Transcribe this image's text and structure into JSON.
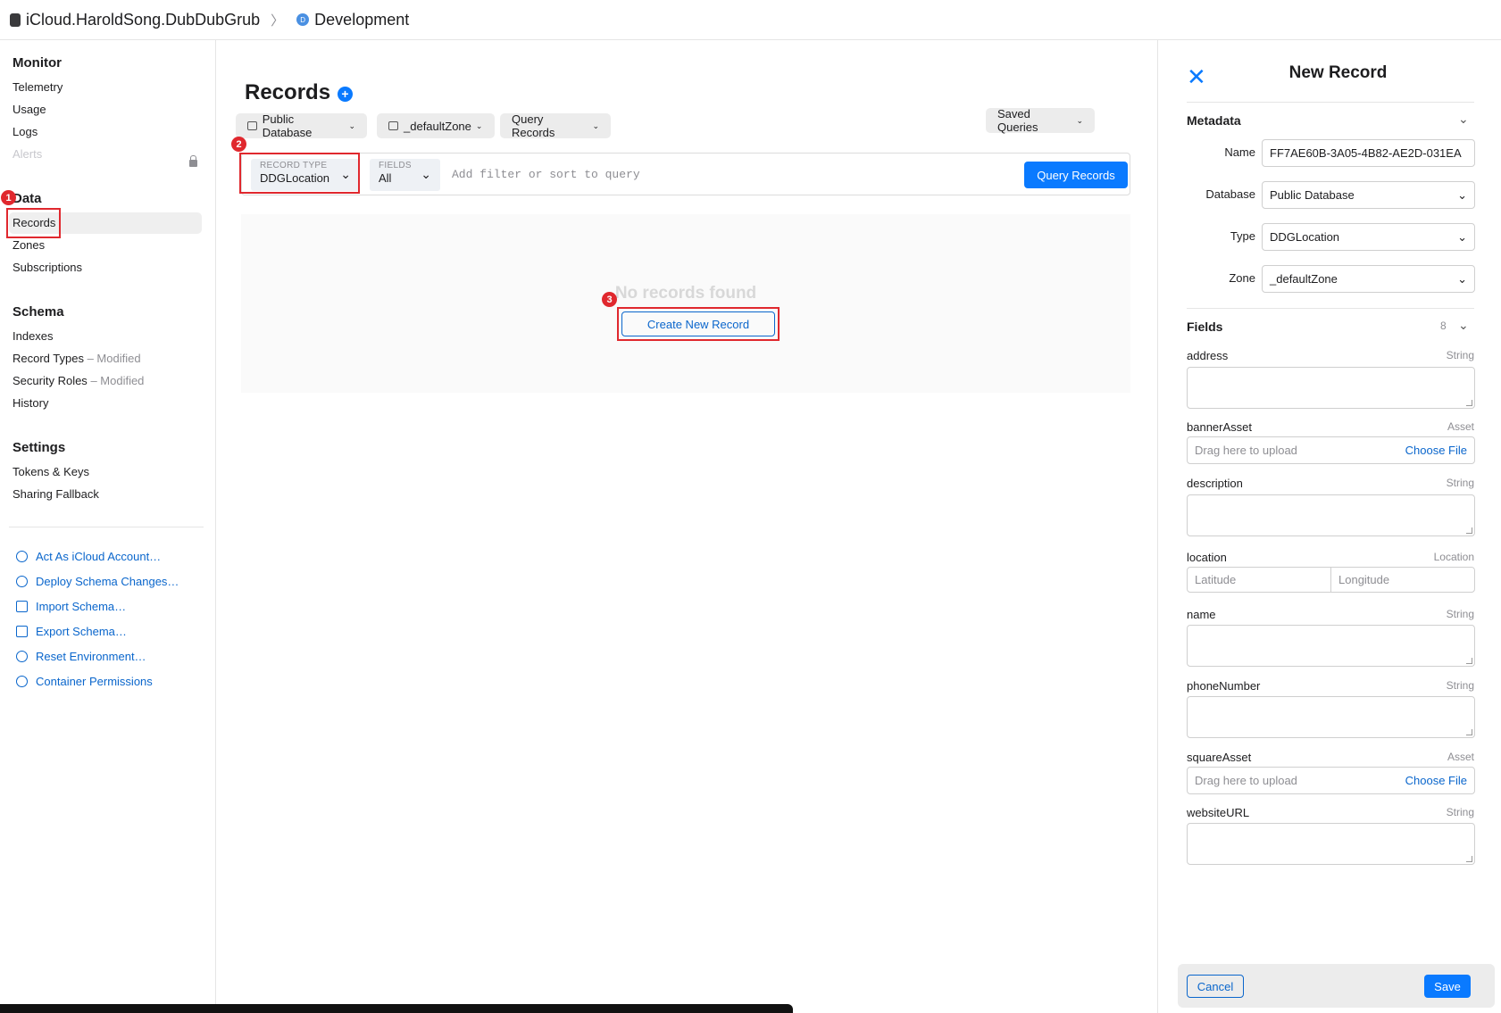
{
  "breadcrumb": {
    "container": "iCloud.HaroldSong.DubDubGrub",
    "environment_initial": "D",
    "environment": "Development"
  },
  "sidebar": {
    "sections": {
      "monitor": {
        "title": "Monitor",
        "items": [
          "Telemetry",
          "Usage",
          "Logs",
          "Alerts"
        ]
      },
      "data": {
        "title": "Data",
        "items": [
          "Records",
          "Zones",
          "Subscriptions"
        ]
      },
      "schema": {
        "title": "Schema",
        "items": [
          "Indexes",
          "Record Types",
          "Security Roles",
          "History"
        ],
        "modified_suffix": "– Modified"
      },
      "settings": {
        "title": "Settings",
        "items": [
          "Tokens & Keys",
          "Sharing Fallback"
        ]
      }
    },
    "actions": [
      "Act As iCloud Account…",
      "Deploy Schema Changes…",
      "Import Schema…",
      "Export Schema…",
      "Reset Environment…",
      "Container Permissions"
    ],
    "selected": "Records"
  },
  "annotations": [
    "1",
    "2",
    "3"
  ],
  "main": {
    "title": "Records",
    "add_icon": "+",
    "toolbar": {
      "database": "Public Database",
      "zone": "_defaultZone",
      "mode": "Query Records",
      "saved_queries": "Saved Queries"
    },
    "query": {
      "record_type_label": "RECORD TYPE",
      "record_type_value": "DDGLocation",
      "fields_label": "FIELDS",
      "fields_value": "All",
      "placeholder": "Add filter or sort to query",
      "button": "Query Records"
    },
    "empty_text": "No records found",
    "create_button": "Create New Record"
  },
  "panel": {
    "title": "New Record",
    "metadata_title": "Metadata",
    "metadata": [
      {
        "label": "Name",
        "value": "FF7AE60B-3A05-4B82-AE2D-031EA"
      },
      {
        "label": "Database",
        "value": "Public Database"
      },
      {
        "label": "Type",
        "value": "DDGLocation"
      },
      {
        "label": "Zone",
        "value": "_defaultZone"
      }
    ],
    "fields_title": "Fields",
    "fields_count": "8",
    "fields": [
      {
        "name": "address",
        "type": "String"
      },
      {
        "name": "bannerAsset",
        "type": "Asset"
      },
      {
        "name": "description",
        "type": "String"
      },
      {
        "name": "location",
        "type": "Location"
      },
      {
        "name": "name",
        "type": "String"
      },
      {
        "name": "phoneNumber",
        "type": "String"
      },
      {
        "name": "squareAsset",
        "type": "Asset"
      },
      {
        "name": "websiteURL",
        "type": "String"
      }
    ],
    "upload_placeholder": "Drag here to upload",
    "choose_file": "Choose File",
    "latitude": "Latitude",
    "longitude": "Longitude",
    "cancel": "Cancel",
    "save": "Save"
  }
}
